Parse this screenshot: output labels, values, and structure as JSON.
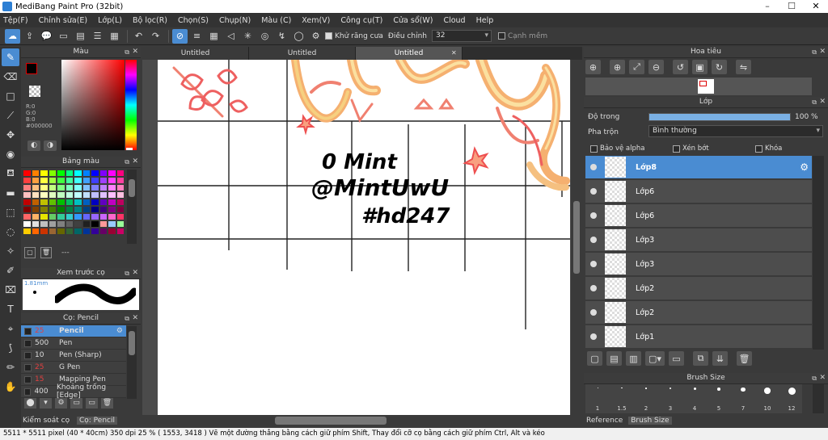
{
  "window": {
    "title": "MediBang Paint Pro (32bit)"
  },
  "menu": [
    "Tệp(F)",
    "Chỉnh sửa(E)",
    "Lớp(L)",
    "Bộ lọc(R)",
    "Chọn(S)",
    "Chụp(N)",
    "Màu (C)",
    "Xem(V)",
    "Công cụ(T)",
    "Cửa sổ(W)",
    "Cloud",
    "Help"
  ],
  "toolbar": {
    "antialias_label": "Khử răng cưa",
    "adjust_label": "Điều chỉnh",
    "adjust_value": "32",
    "edge_label": "Cạnh mềm"
  },
  "color_panel": {
    "title": "Màu",
    "r": "R:0",
    "g": "G:0",
    "b": "B:0",
    "hex": "#000000"
  },
  "palette_panel": {
    "title": "Bảng màu",
    "extra": "---"
  },
  "preview_panel": {
    "title": "Xem trước cọ",
    "size": "1.81mm"
  },
  "brush_panel": {
    "title": "Cọ: Pencil",
    "brushes": [
      {
        "size": "25",
        "name": "Pencil",
        "selected": true
      },
      {
        "size": "500",
        "name": "Pen"
      },
      {
        "size": "10",
        "name": "Pen (Sharp)"
      },
      {
        "size": "25",
        "name": "G Pen",
        "red": true
      },
      {
        "size": "15",
        "name": "Mapping Pen",
        "red": true
      },
      {
        "size": "400",
        "name": "Khoảng trống [Edge]"
      }
    ],
    "bottom_tabs": [
      "Kiểm soát cọ",
      "Cọ: Pencil"
    ]
  },
  "canvas": {
    "tabs": [
      "Untitled",
      "Untitled",
      "Untitled"
    ],
    "text_lines": [
      "0 Mint",
      "@MintUwU",
      "#hd247"
    ]
  },
  "navigator": {
    "title": "Hoa tiêu"
  },
  "layer_panel": {
    "title": "Lớp",
    "opacity_label": "Độ trong",
    "opacity_value": "100 %",
    "opacity_fraction": 1.0,
    "blend_label": "Pha trộn",
    "blend_value": "Bình thường",
    "protect_alpha": "Bảo vệ alpha",
    "clipping": "Xén bớt",
    "lock": "Khóa",
    "layers": [
      "Lớp8",
      "Lớp6",
      "Lớp6",
      "Lớp3",
      "Lớp3",
      "Lớp2",
      "Lớp2",
      "Lớp1"
    ]
  },
  "brush_size_panel": {
    "title": "Brush Size",
    "sizes": [
      "1",
      "1.5",
      "2",
      "3",
      "4",
      "5",
      "7",
      "10",
      "12"
    ],
    "tabs": [
      "Reference",
      "Brush Size"
    ]
  },
  "status": "5511 * 5511 pixel  (40 * 40cm)  350 dpi  25 %  ( 1553, 3418 )  Vẽ một đường thẳng bằng cách giữ phím Shift, Thay đổi cỡ cọ bằng cách giữ phím Ctrl, Alt và kéo",
  "colors": {
    "accent": "#4a8cd2",
    "foreground": "#000000",
    "background": "#ffffff"
  }
}
